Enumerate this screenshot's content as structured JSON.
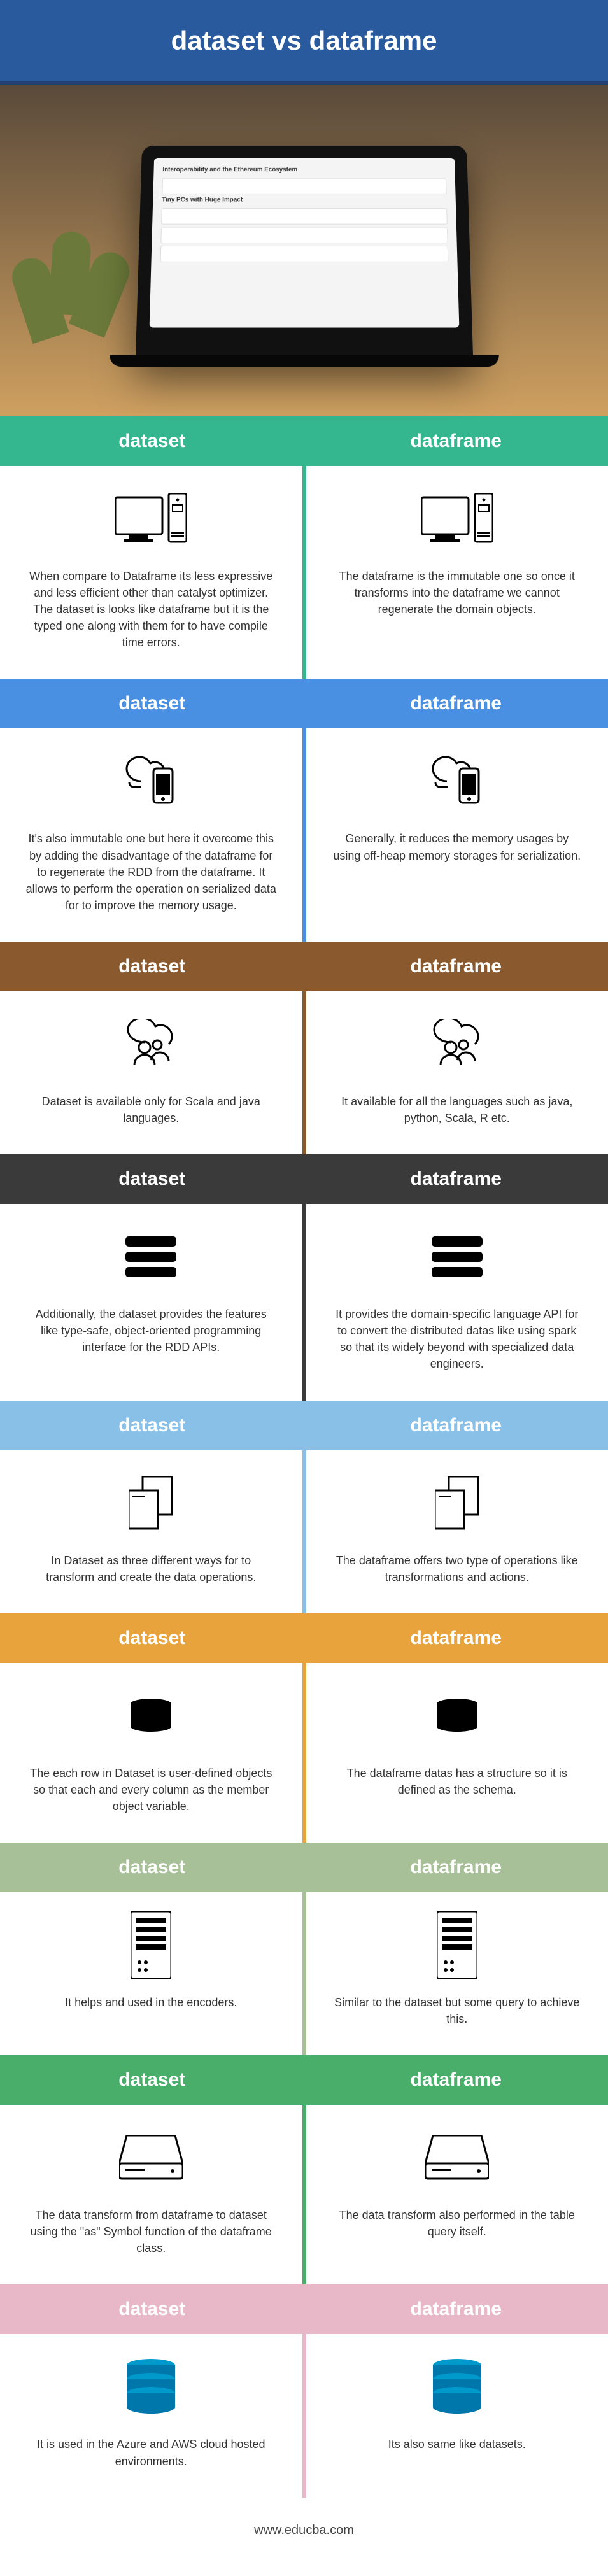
{
  "title": "dataset vs dataframe",
  "hero": {
    "screen_text1": "Interoperability and the Ethereum Ecosystem",
    "screen_text2": "Tiny PCs with Huge Impact"
  },
  "sections": [
    {
      "color": "c-teal",
      "left_label": "dataset",
      "right_label": "dataframe",
      "icon": "computer",
      "left_text": "When compare to Dataframe its less expressive and less efficient other than catalyst optimizer. The dataset is looks like dataframe but it is the typed one along with them for to have compile time errors.",
      "right_text": "The dataframe is the immutable one so once it transforms into the dataframe we cannot regenerate the domain objects."
    },
    {
      "color": "c-blue",
      "left_label": "dataset",
      "right_label": "dataframe",
      "icon": "cloud-phone",
      "left_text": "It's also immutable one but here it overcome this by adding the disadvantage of the dataframe for to regenerate the RDD from the dataframe. It allows to perform the operation on serialized data for to improve the memory usage.",
      "right_text": "Generally, it reduces the memory usages by using off-heap memory storages for serialization."
    },
    {
      "color": "c-brown",
      "left_label": "dataset",
      "right_label": "dataframe",
      "icon": "cloud-people",
      "left_text": "Dataset is available only for Scala and java languages.",
      "right_text": "It available for all the languages such as java, python, Scala, R etc."
    },
    {
      "color": "c-dark",
      "left_label": "dataset",
      "right_label": "dataframe",
      "icon": "bars",
      "left_text": "Additionally, the dataset provides the features like type-safe, object-oriented programming interface for the RDD APIs.",
      "right_text": "It provides the domain-specific language API for to convert the distributed datas like using spark so that its widely beyond with specialized data engineers."
    },
    {
      "color": "c-lightblue",
      "left_label": "dataset",
      "right_label": "dataframe",
      "icon": "docs",
      "left_text": "In Dataset as three different ways for to transform and create the data operations.",
      "right_text": "The dataframe offers two type of operations like transformations and actions."
    },
    {
      "color": "c-orange",
      "left_label": "dataset",
      "right_label": "dataframe",
      "icon": "db-small",
      "left_text": "The each row in Dataset is user-defined objects so that each and every column as the member object variable.",
      "right_text": "The dataframe datas has a structure so it is defined as the schema."
    },
    {
      "color": "c-sage",
      "left_label": "dataset",
      "right_label": "dataframe",
      "icon": "server",
      "left_text": "It helps and used in the encoders.",
      "right_text": "Similar to the dataset but some query to achieve this."
    },
    {
      "color": "c-green",
      "left_label": "dataset",
      "right_label": "dataframe",
      "icon": "drive",
      "left_text": "The data transform from dataframe to dataset using the \"as\" Symbol function of the dataframe class.",
      "right_text": "The data transform also performed in the table query itself."
    },
    {
      "color": "c-pink",
      "left_label": "dataset",
      "right_label": "dataframe",
      "icon": "db-big",
      "left_text": "It is used in the Azure and AWS cloud hosted environments.",
      "right_text": "Its also same like datasets."
    }
  ],
  "footer": "www.educba.com"
}
